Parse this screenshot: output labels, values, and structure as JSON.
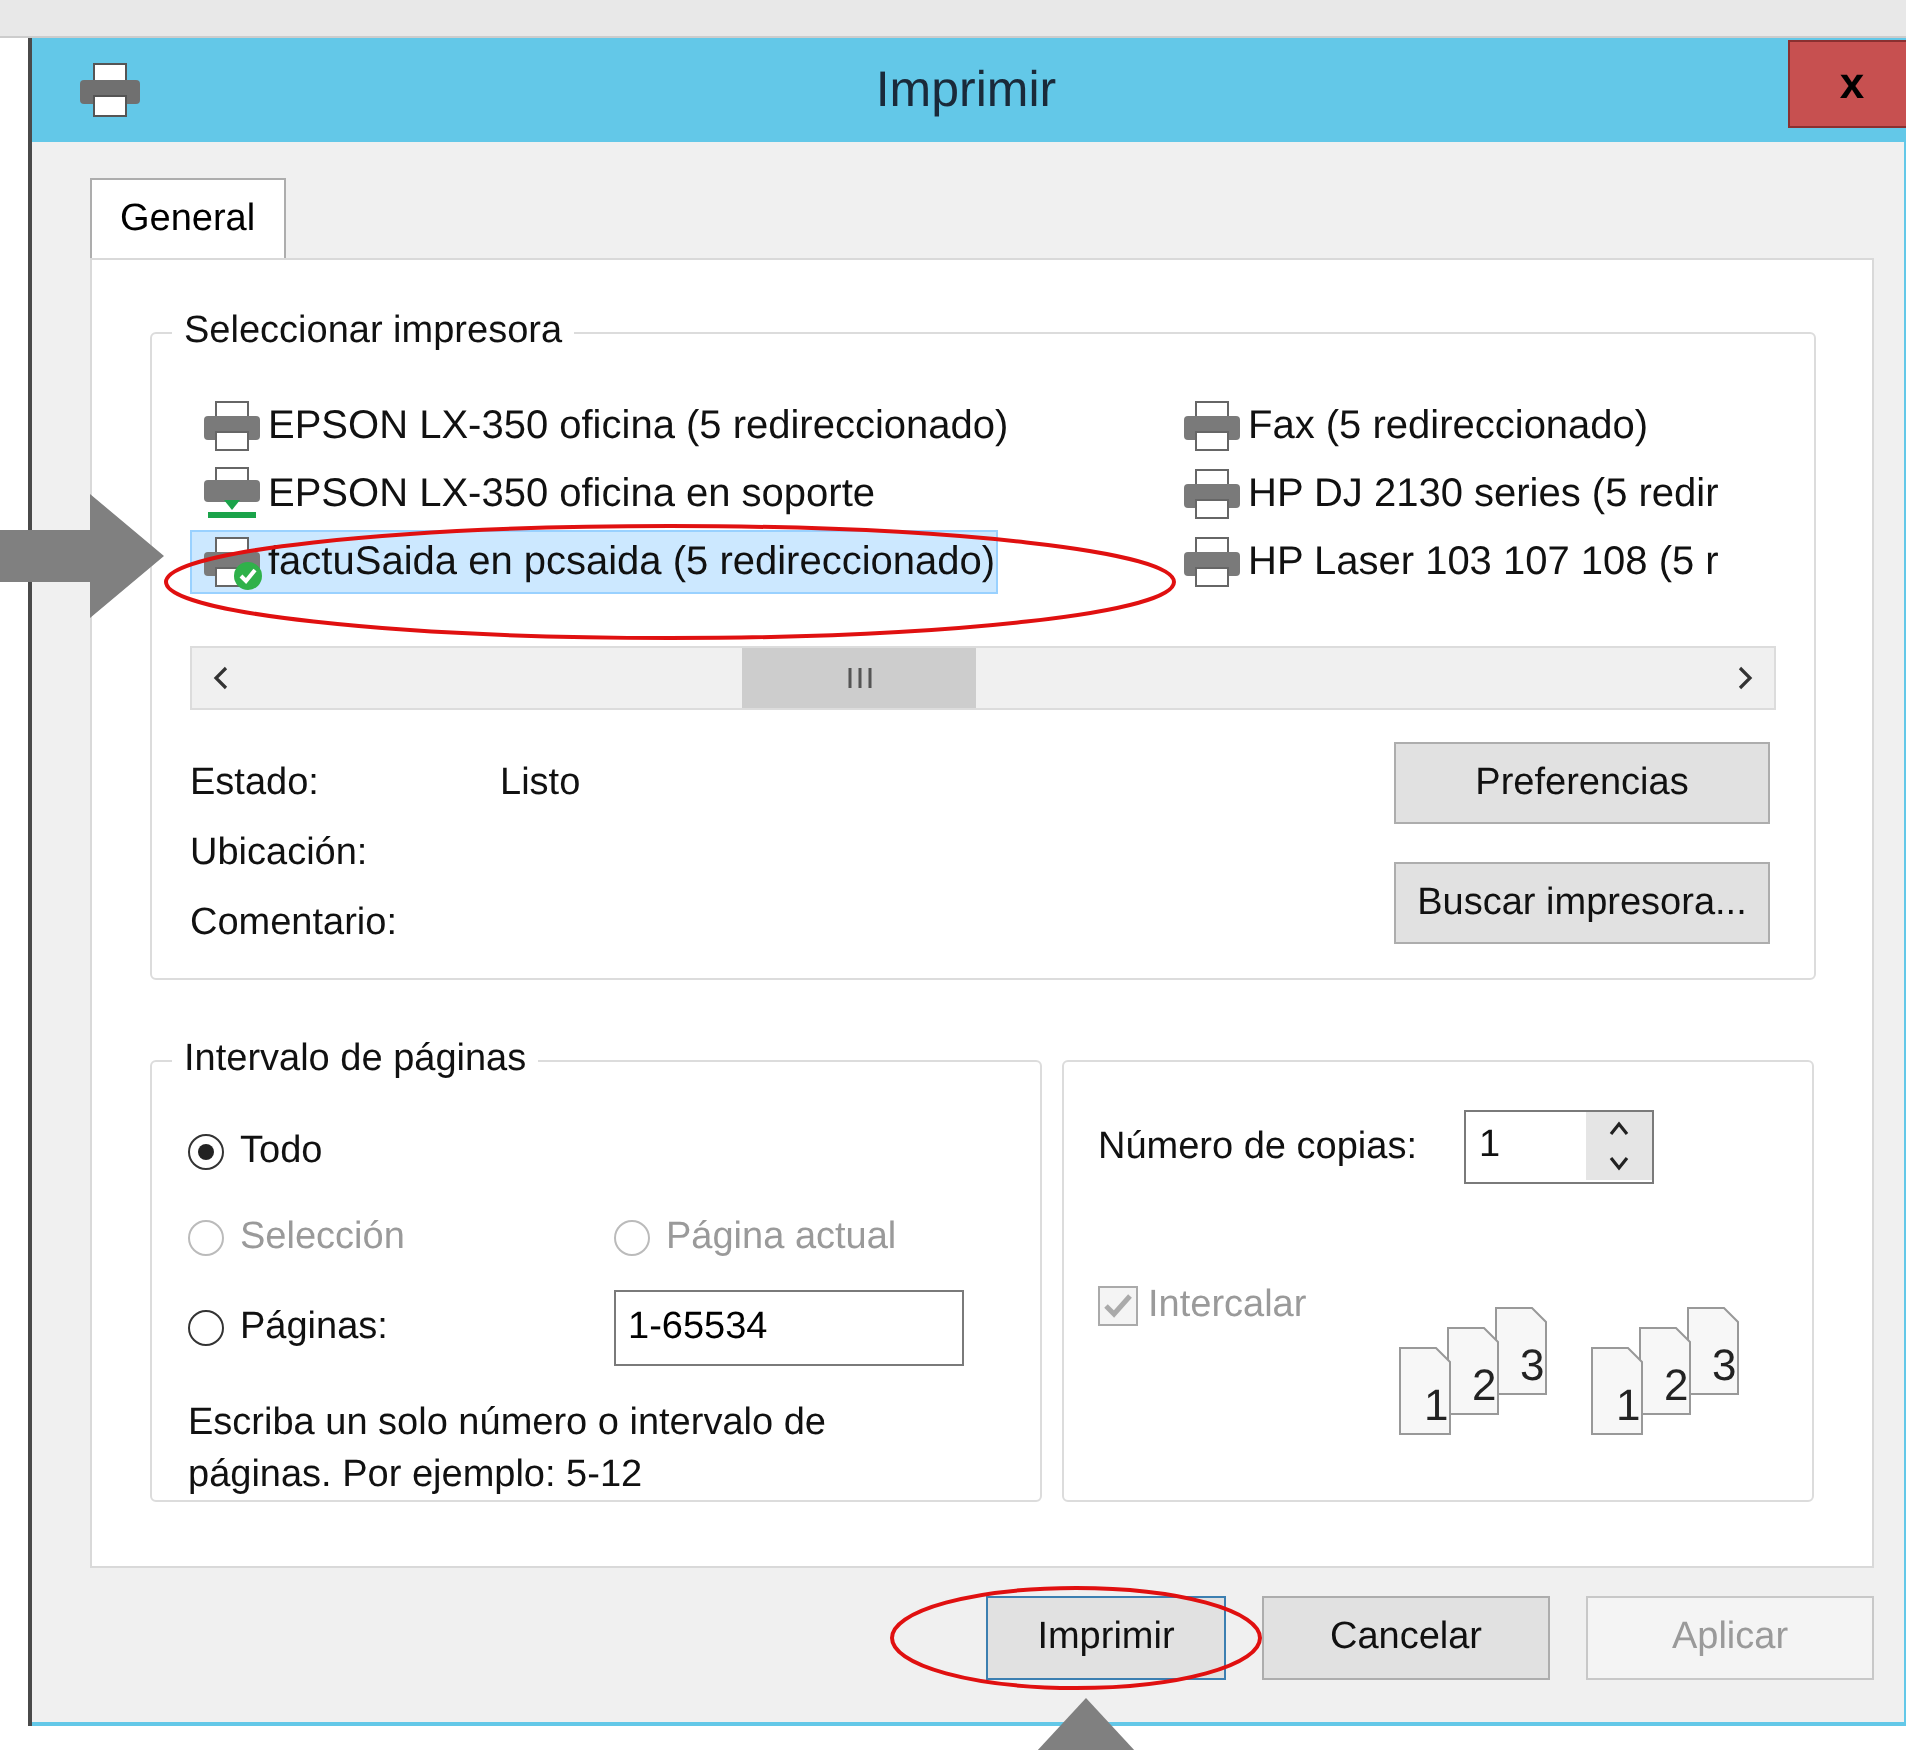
{
  "window": {
    "title": "Imprimir",
    "close": "x"
  },
  "tabs": [
    {
      "label": "General",
      "selected": true
    }
  ],
  "printer_group": {
    "title": "Seleccionar impresora",
    "printers": [
      {
        "name": "EPSON LX-350 oficina (5 redireccionado)",
        "kind": "printer",
        "selected": false
      },
      {
        "name": "EPSON LX-350 oficina en soporte",
        "kind": "bar",
        "selected": false
      },
      {
        "name": "factuSaida en pcsaida (5 redireccionado)",
        "kind": "check",
        "selected": true
      },
      {
        "name": "Fax (5 redireccionado)",
        "kind": "printer",
        "selected": false
      },
      {
        "name": "HP DJ 2130 series (5 redir",
        "kind": "printer",
        "selected": false
      },
      {
        "name": "HP Laser 103 107 108 (5 r",
        "kind": "printer",
        "selected": false
      }
    ],
    "fields": [
      {
        "label": "Estado:",
        "value": "Listo"
      },
      {
        "label": "Ubicación:"
      },
      {
        "label": "Comentario:"
      }
    ],
    "buttons": [
      "Preferencias",
      "Buscar impresora..."
    ]
  },
  "range_group": {
    "title": "Intervalo de páginas",
    "options": [
      {
        "label": "Todo",
        "selected": true,
        "disabled": false
      },
      {
        "label": "Selección",
        "selected": false,
        "disabled": true
      },
      {
        "label": "Página actual",
        "selected": false,
        "disabled": true
      },
      {
        "label": "Páginas:",
        "selected": false,
        "disabled": false
      }
    ],
    "pages_value": "1-65534",
    "hint": "Escriba un solo número o intervalo de páginas. Por ejemplo: 5-12"
  },
  "copies_group": {
    "label": "Número de copias:",
    "value": "1",
    "collate": {
      "label": "Intercalar",
      "checked": true,
      "disabled": true
    },
    "collate_sets": [
      [
        "1",
        "2",
        "3"
      ],
      [
        "1",
        "2",
        "3"
      ]
    ]
  },
  "footer_buttons": [
    {
      "label": "Imprimir",
      "focused": true,
      "disabled": false
    },
    {
      "label": "Cancelar",
      "focused": false,
      "disabled": false
    },
    {
      "label": "Aplicar",
      "focused": false,
      "disabled": true
    }
  ]
}
